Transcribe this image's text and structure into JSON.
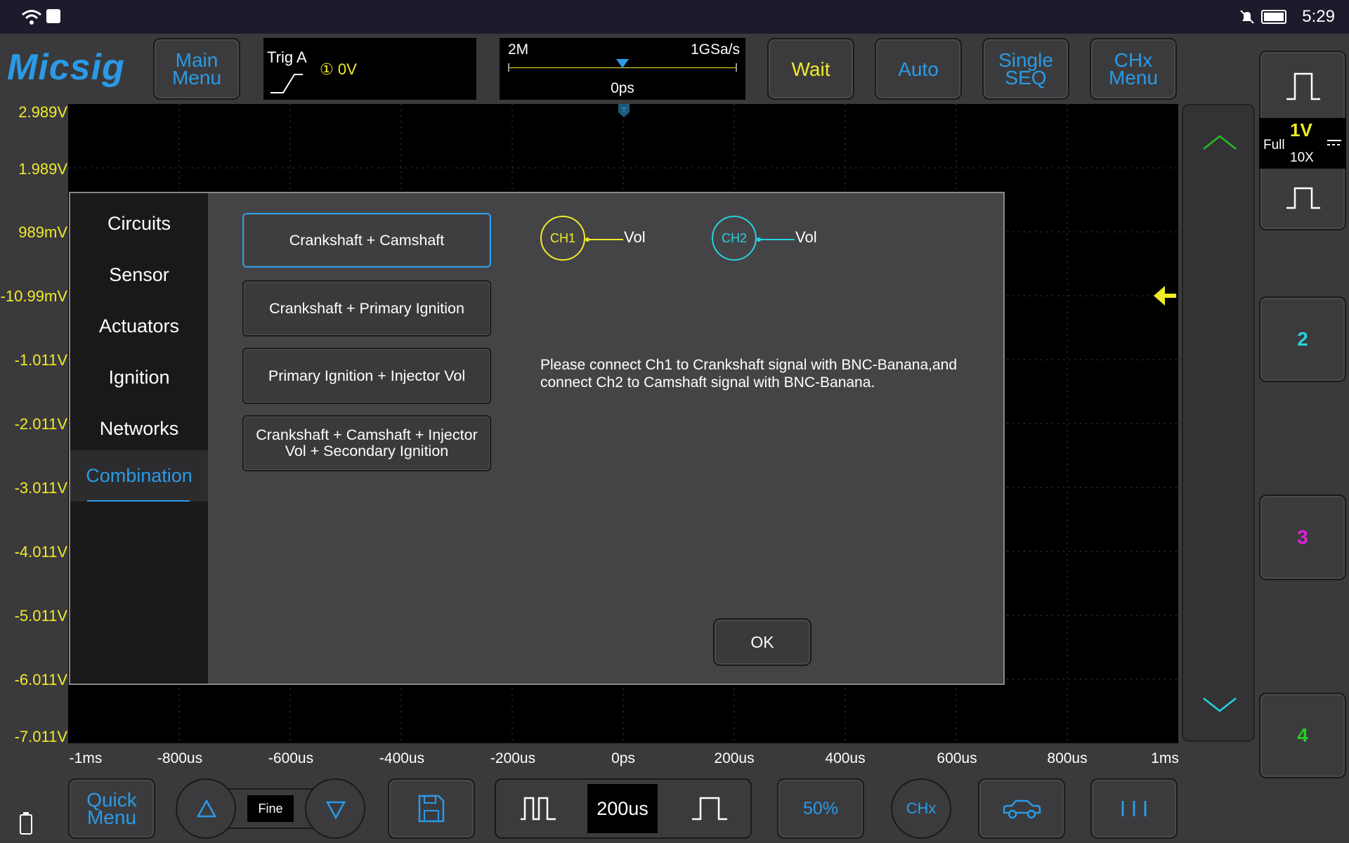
{
  "status": {
    "time": "5:29"
  },
  "logo": "Micsig",
  "top": {
    "main_menu": "Main\nMenu",
    "trig_label": "Trig A",
    "trig_level": "① 0V",
    "memory_depth": "2M",
    "sample_rate": "1GSa/s",
    "trig_position": "0ps",
    "wait": "Wait",
    "auto": "Auto",
    "single_seq": "Single\nSEQ",
    "chx_menu": "CHx\nMenu"
  },
  "volt_labels": [
    "2.989V",
    "1.989V",
    "989mV",
    "-10.99mV",
    "-1.011V",
    "-2.011V",
    "-3.011V",
    "-4.011V",
    "-5.011V",
    "-6.011V",
    "-7.011V"
  ],
  "time_labels": [
    "-1ms",
    "-800us",
    "-600us",
    "-400us",
    "-200us",
    "0ps",
    "200us",
    "400us",
    "600us",
    "800us",
    "1ms"
  ],
  "dialog": {
    "categories": [
      "Circuits",
      "Sensor",
      "Actuators",
      "Ignition",
      "Networks",
      "Combination"
    ],
    "active_category": "Combination",
    "options": [
      "Crankshaft + Camshaft",
      "Crankshaft + Primary Ignition",
      "Primary Ignition + Injector Vol",
      "Crankshaft + Camshaft + Injector Vol + Secondary Ignition"
    ],
    "selected_option": "Crankshaft + Camshaft",
    "ch1": {
      "label": "CH1",
      "signal": "Vol"
    },
    "ch2": {
      "label": "CH2",
      "signal": "Vol"
    },
    "instruction": "Please connect Ch1 to Crankshaft signal with BNC-Banana,and connect Ch2 to Camshaft signal with BNC-Banana.",
    "ok": "OK"
  },
  "right": {
    "ch1_scale": "1V",
    "ch1_bandwidth": "Full",
    "ch1_probe": "10X",
    "ch2": "2",
    "ch3": "3",
    "ch4": "4"
  },
  "bottom": {
    "quick_menu": "Quick\nMenu",
    "fine": "Fine",
    "timebase": "200us",
    "percent": "50%",
    "chx": "CHx"
  },
  "colors": {
    "ch1": "#f0ea2a",
    "ch2": "#25d3e0",
    "ch3": "#e020e0",
    "ch4": "#20d020",
    "accent": "#2a9ae6"
  }
}
